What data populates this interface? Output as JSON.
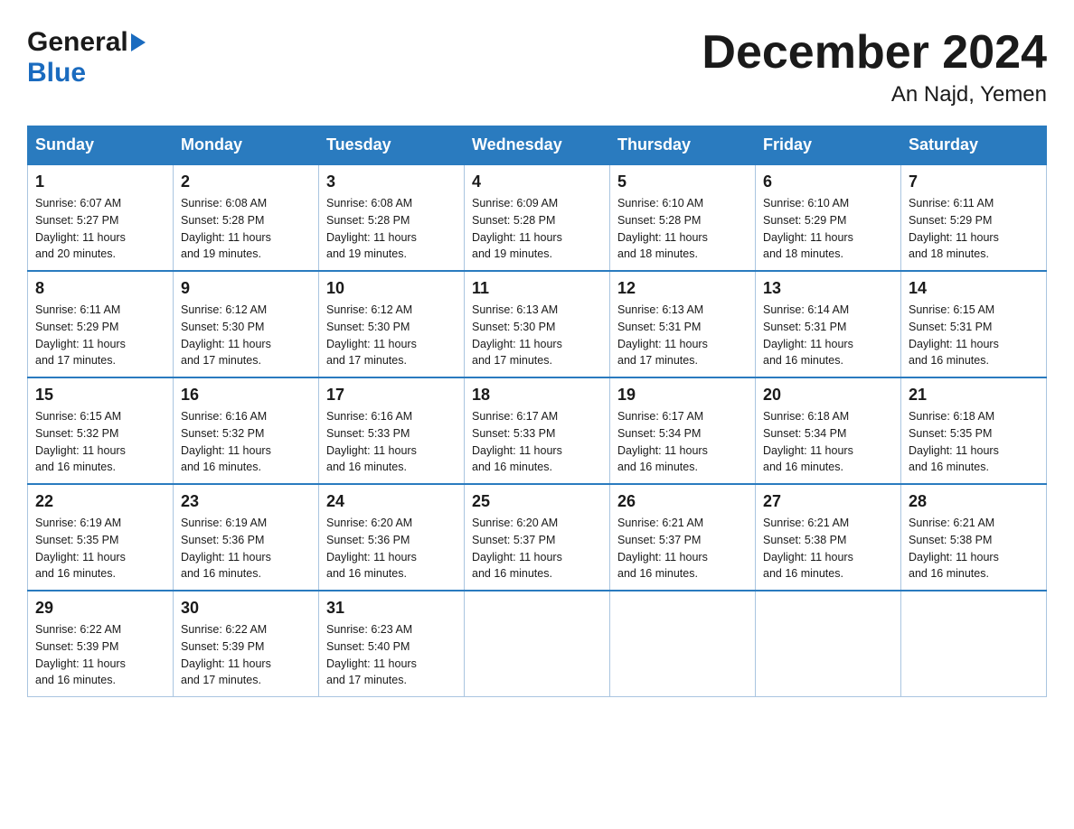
{
  "header": {
    "logo_general": "General",
    "logo_blue": "Blue",
    "month": "December 2024",
    "location": "An Najd, Yemen"
  },
  "days_of_week": [
    "Sunday",
    "Monday",
    "Tuesday",
    "Wednesday",
    "Thursday",
    "Friday",
    "Saturday"
  ],
  "weeks": [
    [
      {
        "day": "1",
        "sunrise": "6:07 AM",
        "sunset": "5:27 PM",
        "daylight": "11 hours and 20 minutes."
      },
      {
        "day": "2",
        "sunrise": "6:08 AM",
        "sunset": "5:28 PM",
        "daylight": "11 hours and 19 minutes."
      },
      {
        "day": "3",
        "sunrise": "6:08 AM",
        "sunset": "5:28 PM",
        "daylight": "11 hours and 19 minutes."
      },
      {
        "day": "4",
        "sunrise": "6:09 AM",
        "sunset": "5:28 PM",
        "daylight": "11 hours and 19 minutes."
      },
      {
        "day": "5",
        "sunrise": "6:10 AM",
        "sunset": "5:28 PM",
        "daylight": "11 hours and 18 minutes."
      },
      {
        "day": "6",
        "sunrise": "6:10 AM",
        "sunset": "5:29 PM",
        "daylight": "11 hours and 18 minutes."
      },
      {
        "day": "7",
        "sunrise": "6:11 AM",
        "sunset": "5:29 PM",
        "daylight": "11 hours and 18 minutes."
      }
    ],
    [
      {
        "day": "8",
        "sunrise": "6:11 AM",
        "sunset": "5:29 PM",
        "daylight": "11 hours and 17 minutes."
      },
      {
        "day": "9",
        "sunrise": "6:12 AM",
        "sunset": "5:30 PM",
        "daylight": "11 hours and 17 minutes."
      },
      {
        "day": "10",
        "sunrise": "6:12 AM",
        "sunset": "5:30 PM",
        "daylight": "11 hours and 17 minutes."
      },
      {
        "day": "11",
        "sunrise": "6:13 AM",
        "sunset": "5:30 PM",
        "daylight": "11 hours and 17 minutes."
      },
      {
        "day": "12",
        "sunrise": "6:13 AM",
        "sunset": "5:31 PM",
        "daylight": "11 hours and 17 minutes."
      },
      {
        "day": "13",
        "sunrise": "6:14 AM",
        "sunset": "5:31 PM",
        "daylight": "11 hours and 16 minutes."
      },
      {
        "day": "14",
        "sunrise": "6:15 AM",
        "sunset": "5:31 PM",
        "daylight": "11 hours and 16 minutes."
      }
    ],
    [
      {
        "day": "15",
        "sunrise": "6:15 AM",
        "sunset": "5:32 PM",
        "daylight": "11 hours and 16 minutes."
      },
      {
        "day": "16",
        "sunrise": "6:16 AM",
        "sunset": "5:32 PM",
        "daylight": "11 hours and 16 minutes."
      },
      {
        "day": "17",
        "sunrise": "6:16 AM",
        "sunset": "5:33 PM",
        "daylight": "11 hours and 16 minutes."
      },
      {
        "day": "18",
        "sunrise": "6:17 AM",
        "sunset": "5:33 PM",
        "daylight": "11 hours and 16 minutes."
      },
      {
        "day": "19",
        "sunrise": "6:17 AM",
        "sunset": "5:34 PM",
        "daylight": "11 hours and 16 minutes."
      },
      {
        "day": "20",
        "sunrise": "6:18 AM",
        "sunset": "5:34 PM",
        "daylight": "11 hours and 16 minutes."
      },
      {
        "day": "21",
        "sunrise": "6:18 AM",
        "sunset": "5:35 PM",
        "daylight": "11 hours and 16 minutes."
      }
    ],
    [
      {
        "day": "22",
        "sunrise": "6:19 AM",
        "sunset": "5:35 PM",
        "daylight": "11 hours and 16 minutes."
      },
      {
        "day": "23",
        "sunrise": "6:19 AM",
        "sunset": "5:36 PM",
        "daylight": "11 hours and 16 minutes."
      },
      {
        "day": "24",
        "sunrise": "6:20 AM",
        "sunset": "5:36 PM",
        "daylight": "11 hours and 16 minutes."
      },
      {
        "day": "25",
        "sunrise": "6:20 AM",
        "sunset": "5:37 PM",
        "daylight": "11 hours and 16 minutes."
      },
      {
        "day": "26",
        "sunrise": "6:21 AM",
        "sunset": "5:37 PM",
        "daylight": "11 hours and 16 minutes."
      },
      {
        "day": "27",
        "sunrise": "6:21 AM",
        "sunset": "5:38 PM",
        "daylight": "11 hours and 16 minutes."
      },
      {
        "day": "28",
        "sunrise": "6:21 AM",
        "sunset": "5:38 PM",
        "daylight": "11 hours and 16 minutes."
      }
    ],
    [
      {
        "day": "29",
        "sunrise": "6:22 AM",
        "sunset": "5:39 PM",
        "daylight": "11 hours and 16 minutes."
      },
      {
        "day": "30",
        "sunrise": "6:22 AM",
        "sunset": "5:39 PM",
        "daylight": "11 hours and 17 minutes."
      },
      {
        "day": "31",
        "sunrise": "6:23 AM",
        "sunset": "5:40 PM",
        "daylight": "11 hours and 17 minutes."
      },
      null,
      null,
      null,
      null
    ]
  ],
  "labels": {
    "sunrise": "Sunrise:",
    "sunset": "Sunset:",
    "daylight": "Daylight:"
  }
}
